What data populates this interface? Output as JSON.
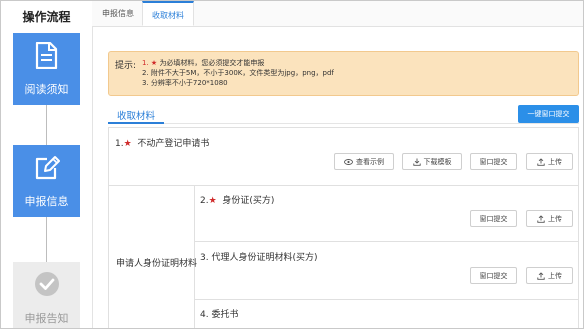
{
  "sidebar": {
    "title": "操作流程",
    "steps": [
      {
        "label": "阅读须知",
        "icon": "document-icon",
        "state": "active"
      },
      {
        "label": "申报信息",
        "icon": "edit-icon",
        "state": "active"
      },
      {
        "label": "申报告知",
        "icon": "check-circle-icon",
        "state": "disabled"
      }
    ]
  },
  "tabs": [
    {
      "label": "申报信息",
      "active": false
    },
    {
      "label": "收取材料",
      "active": true
    }
  ],
  "notice": {
    "title": "提示:",
    "lines": [
      {
        "num": "1.",
        "text": "为必填材料，您必须提交才能申报",
        "star": true
      },
      {
        "num": "2.",
        "text": "附件不大于5M，不小于300K，文件类型为jpg，png，pdf",
        "star": false
      },
      {
        "num": "3.",
        "text": "分辨率不小于720*1080",
        "star": false
      }
    ]
  },
  "section": {
    "title": "收取材料",
    "submit_all": "一键窗口提交"
  },
  "materials": {
    "row1": {
      "num": "1.",
      "title": "不动产登记申请书",
      "required": true,
      "buttons": {
        "example": "查看示例",
        "download": "下载模板",
        "window": "窗口提交",
        "upload": "上传"
      }
    },
    "group_label": "申请人身份证明材料",
    "items": [
      {
        "num": "2.",
        "title": "身份证(买方)",
        "required": true,
        "window": "窗口提交",
        "upload": "上传"
      },
      {
        "num": "3.",
        "title": "代理人身份证明材料(买方)",
        "required": false,
        "window": "窗口提交",
        "upload": "上传"
      },
      {
        "num": "4.",
        "title": "委托书",
        "required": false
      }
    ]
  },
  "colors": {
    "accent": "#2b7fd8",
    "step_bg": "#4a8fe7",
    "required_star": "#d02a2a",
    "notice_bg": "#fbe3bd"
  }
}
